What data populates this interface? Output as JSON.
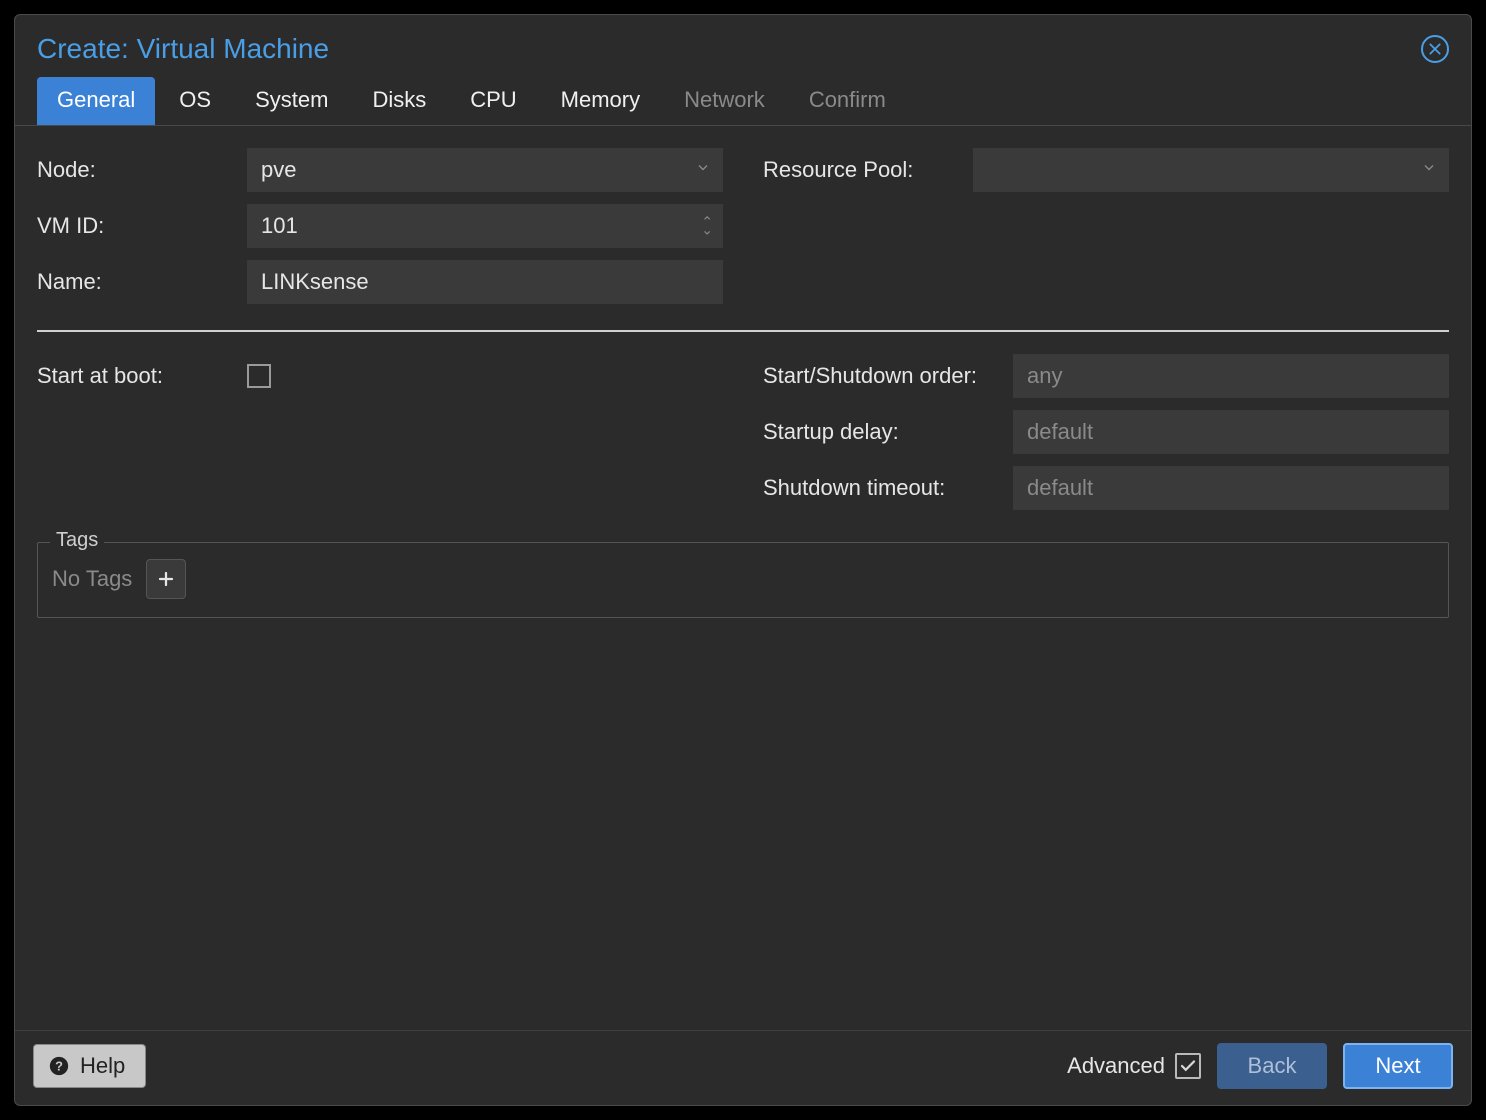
{
  "dialog": {
    "title": "Create: Virtual Machine"
  },
  "tabs": {
    "general": "General",
    "os": "OS",
    "system": "System",
    "disks": "Disks",
    "cpu": "CPU",
    "memory": "Memory",
    "network": "Network",
    "confirm": "Confirm"
  },
  "left": {
    "node_label": "Node:",
    "node_value": "pve",
    "vmid_label": "VM ID:",
    "vmid_value": "101",
    "name_label": "Name:",
    "name_value": "LINKsense"
  },
  "right": {
    "pool_label": "Resource Pool:",
    "pool_value": ""
  },
  "boot": {
    "start_label": "Start at boot:"
  },
  "order": {
    "order_label": "Start/Shutdown order:",
    "order_ph": "any",
    "delay_label": "Startup delay:",
    "delay_ph": "default",
    "timeout_label": "Shutdown timeout:",
    "timeout_ph": "default"
  },
  "tags": {
    "legend": "Tags",
    "empty": "No Tags"
  },
  "footer": {
    "help": "Help",
    "advanced": "Advanced",
    "back": "Back",
    "next": "Next"
  }
}
